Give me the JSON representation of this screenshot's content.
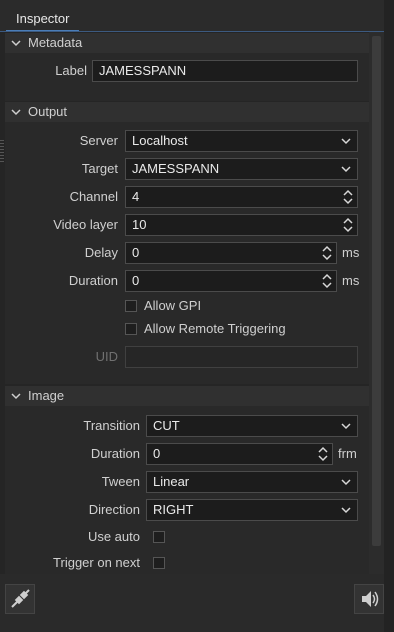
{
  "tab": {
    "label": "Inspector"
  },
  "metadata": {
    "title": "Metadata",
    "label_caption": "Label",
    "label_value": "JAMESSPANN"
  },
  "output": {
    "title": "Output",
    "server_caption": "Server",
    "server_value": "Localhost",
    "target_caption": "Target",
    "target_value": "JAMESSPANN",
    "channel_caption": "Channel",
    "channel_value": "4",
    "video_layer_caption": "Video layer",
    "video_layer_value": "10",
    "delay_caption": "Delay",
    "delay_value": "0",
    "delay_unit": "ms",
    "duration_caption": "Duration",
    "duration_value": "0",
    "duration_unit": "ms",
    "allow_gpi_label": "Allow GPI",
    "allow_remote_label": "Allow Remote Triggering",
    "uid_caption": "UID",
    "uid_value": ""
  },
  "image": {
    "title": "Image",
    "transition_caption": "Transition",
    "transition_value": "CUT",
    "duration_caption": "Duration",
    "duration_value": "0",
    "duration_unit": "frm",
    "tween_caption": "Tween",
    "tween_value": "Linear",
    "direction_caption": "Direction",
    "direction_value": "RIGHT",
    "use_auto_caption": "Use auto",
    "trigger_next_caption": "Trigger on next"
  },
  "icons": {
    "disconnect": "plug-disconnect-icon",
    "sound": "speaker-icon"
  }
}
